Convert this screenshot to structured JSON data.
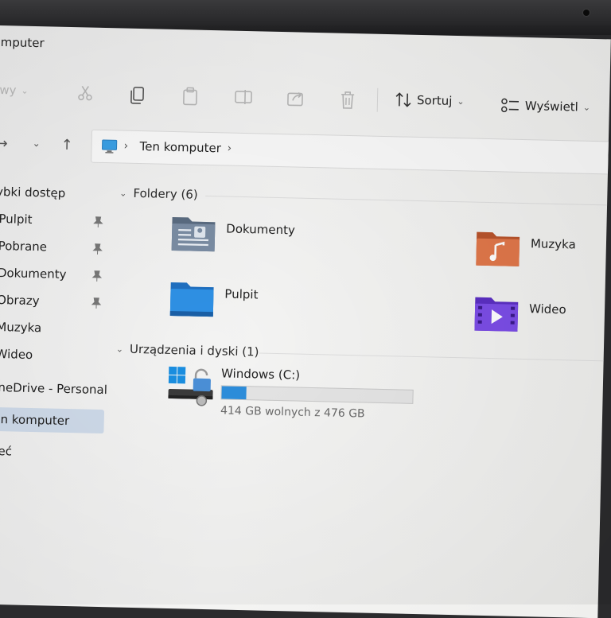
{
  "window": {
    "title": "omputer"
  },
  "toolbar": {
    "new_label": "owy",
    "sort_label": "Sortuj",
    "view_label": "Wyświetl"
  },
  "address": {
    "location": "Ten komputer"
  },
  "sidebar": {
    "quick_access": "zybki dostęp",
    "pinned": [
      {
        "label": "Pulpit"
      },
      {
        "label": "Pobrane"
      },
      {
        "label": "Dokumenty"
      },
      {
        "label": "Obrazy"
      }
    ],
    "items": [
      {
        "label": "Muzyka"
      },
      {
        "label": "Wideo"
      }
    ],
    "onedrive": "OneDrive - Personal",
    "this_pc": "Ten komputer",
    "network": "Sieć"
  },
  "folders_group": {
    "header": "Foldery (6)",
    "items": [
      {
        "name": "Dokumenty",
        "icon": "documents-folder-icon"
      },
      {
        "name": "Muzyka",
        "icon": "music-folder-icon"
      },
      {
        "name": "Pulpit",
        "icon": "desktop-folder-icon"
      },
      {
        "name": "Wideo",
        "icon": "video-folder-icon"
      }
    ]
  },
  "drives_group": {
    "header": "Urządzenia i dyski (1)",
    "drive": {
      "name": "Windows (C:)",
      "free_text": "414 GB wolnych z 476 GB",
      "used_fraction": 0.13
    }
  },
  "colors": {
    "accent": "#2c8ddb",
    "selected": "#cdd9e8"
  }
}
